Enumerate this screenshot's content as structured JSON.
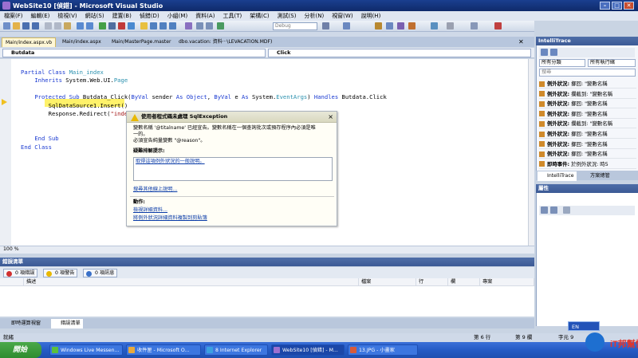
{
  "window": {
    "title": "WebSite10 [偵錯] - Microsoft Visual Studio",
    "controls": [
      "–",
      "□",
      "✕"
    ]
  },
  "menu": [
    "檔案(F)",
    "編輯(E)",
    "檢視(V)",
    "網站(S)",
    "建置(B)",
    "偵錯(D)",
    "小組(M)",
    "資料(A)",
    "工具(T)",
    "架構(C)",
    "測試(S)",
    "分析(N)",
    "視窗(W)",
    "說明(H)"
  ],
  "toolbar": {
    "config": "Debug"
  },
  "doc_tabs": [
    "Main/index.aspx.vb",
    "Main/index.aspx",
    "Main/MasterPage.master",
    "dbo.vacation: 資料···\\LEVACATION.MDF)"
  ],
  "combos": {
    "left": "Butdata",
    "right": "Click"
  },
  "code_lines": [
    [
      "kw:Partial Class ",
      "ty:Main_index"
    ],
    [
      "pl:    ",
      "kw:Inherits ",
      "pl:System.Web.UI.",
      "ty:Page"
    ],
    [
      "pl:"
    ],
    [
      "pl:    ",
      "kw:Protected Sub ",
      "pl:Butdata_Click(",
      "kw:ByVal ",
      "pl:sender ",
      "kw:As Object",
      "pl:, ",
      "kw:ByVal ",
      "pl:e ",
      "kw:As ",
      "pl:System.",
      "ty:EventArgs",
      "pl:) ",
      "kw:Handles ",
      "pl:Butdata.Click"
    ],
    [
      "pl:        SqlDataSource1.Insert()"
    ],
    [
      "pl:        Response.Redirect(",
      "str:\"index.aspx\"",
      "pl:)"
    ],
    [
      "pl:"
    ],
    [
      "pl:"
    ],
    [
      "pl:    ",
      "kw:End Sub"
    ],
    [
      "kw:End Class"
    ]
  ],
  "zoom": "100 %",
  "exception_popup": {
    "title": "使用者程式碼未處理 SqlException",
    "message_line1": "變數名稱 '@titalname' 已經宣告。變數名稱在一個查詢批次或預存程序內必須是唯",
    "message_line2": "一的。",
    "message_line3": "必須宣告純量變數 \"@reason\"。",
    "tips_heading": "疑難排解提示:",
    "tip_link": "取得這項例外狀況的一般說明。",
    "search_link": "搜尋其他線上說明...",
    "actions_heading": "動作:",
    "action1": "檢視詳細資料...",
    "action2": "將例外狀況詳細資料複製到剪貼簿",
    "close": "×"
  },
  "error_list": {
    "title": "錯誤清單",
    "errors": "0 項錯誤",
    "warnings": "0 項警告",
    "messages": "0 項訊息",
    "columns": [
      "描述",
      "檔案",
      "行",
      "欄",
      "專案"
    ]
  },
  "bottom_tabs": [
    "即時運算視窗",
    "錯誤清單"
  ],
  "status_bar": {
    "left": "就緒",
    "line": "第 6 行",
    "col": "第 9 欄",
    "char": "字元 9"
  },
  "intellitrace": {
    "title": "IntelliTrace",
    "filter1": "所有分類",
    "filter2": "所有執行緒",
    "search": "搜尋",
    "events": [
      {
        "type": "例外狀況:",
        "text": "擲回: \"變數名稱"
      },
      {
        "type": "例外狀況:",
        "text": "攔截到: \"變數名稱"
      },
      {
        "type": "例外狀況:",
        "text": "擲回: \"變數名稱"
      },
      {
        "type": "例外狀況:",
        "text": "擲回: \"變數名稱"
      },
      {
        "type": "例外狀況:",
        "text": "攔截到: \"變數名稱"
      },
      {
        "type": "例外狀況:",
        "text": "擲回: \"變數名稱"
      },
      {
        "type": "例外狀況:",
        "text": "擲回: \"變數名稱"
      },
      {
        "type": "例外狀況:",
        "text": "擲回: \"變數名稱"
      },
      {
        "type": "即時事件:",
        "text": "於例外狀況: 時5"
      }
    ],
    "tabs": [
      "IntelliTrace",
      "方案總管"
    ]
  },
  "properties": {
    "title": "屬性"
  },
  "lang": "EN",
  "taskbar": {
    "start": "開始",
    "tasks": [
      "Windows Live Messen...",
      "收件匣 - Microsoft O...",
      "8 Internet Explorer",
      "WebSite10 [偵錯] - M...",
      "13.JPG - 小畫家"
    ]
  },
  "logo_text": "iT邦幫忙"
}
